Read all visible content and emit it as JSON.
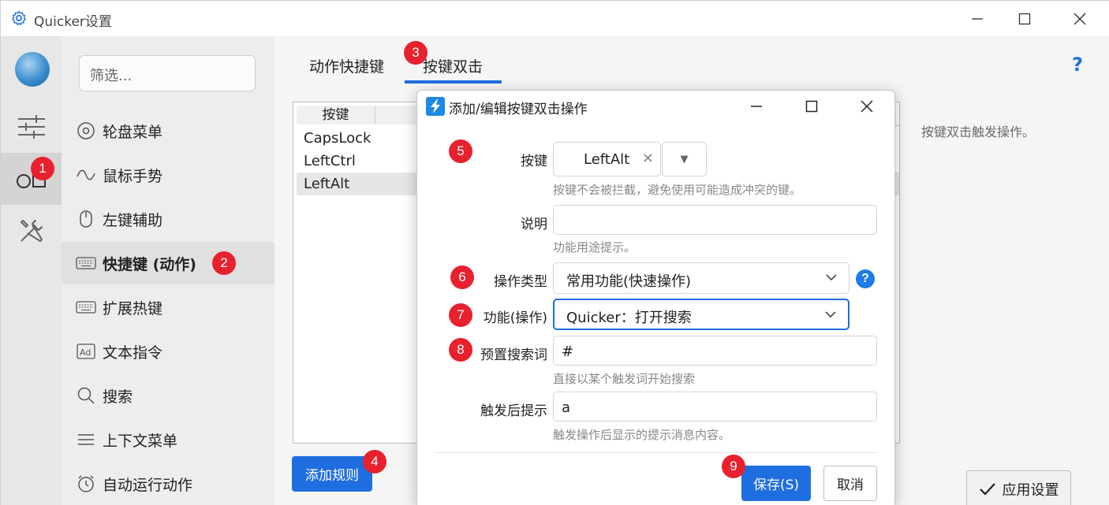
{
  "window": {
    "title": "Quicker设置"
  },
  "nav": {
    "filter_placeholder": "筛选...",
    "items": [
      {
        "label": "轮盘菜单",
        "icon": "wheel-icon"
      },
      {
        "label": "鼠标手势",
        "icon": "wave-icon"
      },
      {
        "label": "左键辅助",
        "icon": "mouse-icon"
      },
      {
        "label": "快捷键 (动作)",
        "icon": "keyboard-icon"
      },
      {
        "label": "扩展热键",
        "icon": "keyboard-icon"
      },
      {
        "label": "文本指令",
        "icon": "ad-text-icon"
      },
      {
        "label": "搜索",
        "icon": "search-icon"
      },
      {
        "label": "上下文菜单",
        "icon": "menu-lines-icon"
      },
      {
        "label": "自动运行动作",
        "icon": "alarm-clock-icon"
      }
    ]
  },
  "tabs": [
    {
      "label": "动作快捷键"
    },
    {
      "label": "按键双击"
    }
  ],
  "table": {
    "header": "按键",
    "rows": [
      "CapsLock",
      "LeftCtrl",
      "LeftAlt"
    ]
  },
  "main": {
    "info_text": "按键双击触发操作。",
    "add_rule_label": "添加规则",
    "apply_label": "应用设置",
    "help_mark": "?"
  },
  "dialog": {
    "title": "添加/编辑按键双击操作",
    "key_label": "按键",
    "key_value": "LeftAlt",
    "key_hint": "按键不会被拦截，避免使用可能造成冲突的键。",
    "desc_label": "说明",
    "desc_value": "",
    "desc_hint": "功能用途提示。",
    "op_type_label": "操作类型",
    "op_type_value": "常用功能(快速操作)",
    "func_label": "功能(操作)",
    "func_value": "Quicker：打开搜索",
    "preset_label": "预置搜索词",
    "preset_value": "#",
    "preset_hint": "直接以某个触发词开始搜索",
    "after_label": "触发后提示",
    "after_value": "a",
    "after_hint": "触发操作后显示的提示消息内容。",
    "save_label": "保存(S)",
    "cancel_label": "取消",
    "help_mark": "?"
  },
  "badges": [
    "1",
    "2",
    "3",
    "4",
    "5",
    "6",
    "7",
    "8",
    "9"
  ],
  "colors": {
    "accent": "#1f6ee0",
    "badge": "#e8212e"
  }
}
